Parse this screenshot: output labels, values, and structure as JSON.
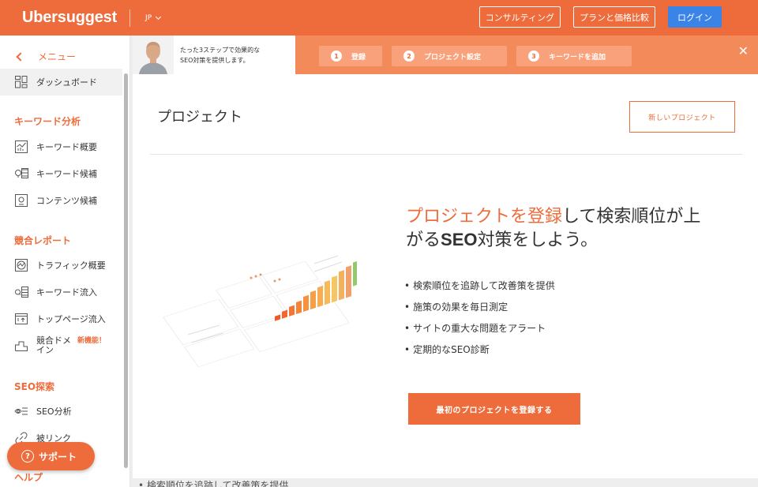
{
  "header": {
    "brand": "Ubersuggest",
    "lang": "JP",
    "buttons": {
      "consulting": "コンサルティング",
      "plans": "プランと価格比較",
      "login": "ログイン"
    }
  },
  "sidebar": {
    "back": "メニュー",
    "dashboard": "ダッシュボード",
    "sections": {
      "keyword": "キーワード分析",
      "competitor": "競合レポート",
      "seo": "SEO探索",
      "help": "ヘルプ"
    },
    "items": {
      "keyword_overview": "キーワード概要",
      "keyword_ideas": "キーワード候補",
      "content_ideas": "コンテンツ候補",
      "traffic_overview": "トラフィック概要",
      "keyword_inflow": "キーワード流入",
      "top_pages": "トップページ流入",
      "competitor_domain": "競合ドメ\nイン",
      "new_badge": "新機能！",
      "seo_analysis": "SEO分析",
      "backlinks": "被リンク"
    },
    "support": "サポート"
  },
  "onboarding": {
    "text_line1": "たった3ステップで効果的な",
    "text_line2": "SEO対策を提供します。",
    "steps": [
      {
        "num": "1",
        "label": "登録"
      },
      {
        "num": "2",
        "label": "プロジェクト設定"
      },
      {
        "num": "3",
        "label": "キーワードを追加"
      }
    ],
    "close": "✕"
  },
  "main": {
    "title": "プロジェクト",
    "new_project": "新しいプロジェクト",
    "hero_highlight": "プロジェクトを登録",
    "hero_rest1": "して検索順位が上",
    "hero_rest2a": "がる",
    "hero_seo": "SEO",
    "hero_rest2b": "対策をしよう。",
    "features": [
      "検索順位を追跡して改善策を提供",
      "施策の効果を毎日測定",
      "サイトの重大な問題をアラート",
      "定期的なSEO診断"
    ],
    "cta": "最初のプロジェクトを登録する"
  },
  "bottom_peek": "• 検索順位を追跡して改善策を提供",
  "colors": {
    "accent": "#ee6c3b",
    "login": "#3a84e8"
  }
}
